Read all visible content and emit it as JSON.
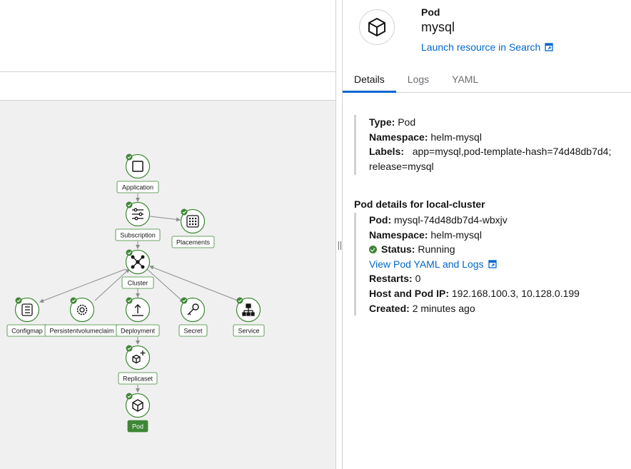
{
  "panel": {
    "kind": "Pod",
    "name": "mysql",
    "launch_link": "Launch resource in Search",
    "tabs": [
      {
        "label": "Details",
        "active": true
      },
      {
        "label": "Logs",
        "active": false
      },
      {
        "label": "YAML",
        "active": false
      }
    ],
    "details": {
      "type_label": "Type:",
      "type_value": "Pod",
      "namespace_label": "Namespace:",
      "namespace_value": "helm-mysql",
      "labels_label": "Labels:",
      "labels_value1": "app=mysql,pod-template-hash=74d48db7d4;",
      "labels_value2": "release=mysql"
    },
    "pod_details": {
      "title": "Pod details for local-cluster",
      "pod_label": "Pod:",
      "pod_value": "mysql-74d48db7d4-wbxjv",
      "namespace_label": "Namespace:",
      "namespace_value": "helm-mysql",
      "status_label": "Status:",
      "status_value": "Running",
      "yaml_logs_link": "View Pod YAML and Logs",
      "restarts_label": "Restarts:",
      "restarts_value": "0",
      "ip_label": "Host and Pod IP:",
      "ip_value": "192.168.100.3, 10.128.0.199",
      "created_label": "Created:",
      "created_value": "2 minutes ago"
    }
  },
  "topology": {
    "nodes": [
      {
        "id": "application",
        "label": "Application",
        "icon": "application-icon"
      },
      {
        "id": "subscription",
        "label": "Subscription",
        "icon": "subscription-icon"
      },
      {
        "id": "placements",
        "label": "Placements",
        "icon": "placements-icon"
      },
      {
        "id": "cluster",
        "label": "Cluster",
        "icon": "cluster-icon"
      },
      {
        "id": "configmap",
        "label": "Configmap",
        "icon": "configmap-icon"
      },
      {
        "id": "pvc",
        "label": "Persistentvolumeclaim",
        "icon": "gear-icon"
      },
      {
        "id": "deployment",
        "label": "Deployment",
        "icon": "deployment-icon"
      },
      {
        "id": "secret",
        "label": "Secret",
        "icon": "key-icon"
      },
      {
        "id": "service",
        "label": "Service",
        "icon": "service-icon"
      },
      {
        "id": "replicaset",
        "label": "Replicaset",
        "icon": "replicaset-icon"
      },
      {
        "id": "pod",
        "label": "Pod",
        "icon": "cube-icon",
        "selected": true
      }
    ]
  },
  "colors": {
    "accent": "#0066cc",
    "success": "#3e8635",
    "selected_label_bg": "#3e8635",
    "canvas_bg": "#f0f0f0"
  }
}
